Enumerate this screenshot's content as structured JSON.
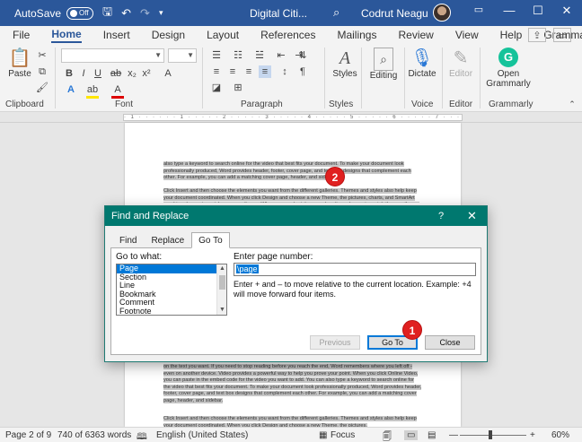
{
  "titlebar": {
    "autosave_label": "AutoSave",
    "autosave_state": "Off",
    "doc_title": "Digital Citi...",
    "user_name": "Codrut Neagu"
  },
  "menu": {
    "items": [
      "File",
      "Home",
      "Insert",
      "Design",
      "Layout",
      "References",
      "Mailings",
      "Review",
      "View",
      "Help",
      "Grammarly"
    ],
    "active": "Home"
  },
  "ribbon": {
    "groups": [
      "Clipboard",
      "Font",
      "Paragraph",
      "Styles",
      "Voice",
      "Editor",
      "Grammarly"
    ],
    "paste_label": "Paste",
    "styles_label": "Styles",
    "editing_label": "Editing",
    "dictate_label": "Dictate",
    "editor_label": "Editor",
    "open_grammarly_label": "Open Grammarly"
  },
  "document": {
    "paragraphs": [
      "also type a keyword to search online for the video that best fits your document. To make your document look professionally produced, Word provides header, footer, cover page, and text box designs that complement each other. For example, you can add a matching cover page, header, and sidebar.",
      "Click Insert and then choose the elements you want from the different galleries. Themes and styles also help keep your document coordinated. When you click Design and choose a new Theme, the pictures, charts, and SmartArt graphics change to match your new theme. When you apply styles, your headings change to match the new theme.",
      "on the text you want. If you need to stop reading before you reach the end, Word remembers where you left off - even on another device. Video provides a powerful way to help you prove your point. When you click Online Video, you can paste in the embed code for the video you want to add. You can also type a keyword to search online for the video that best fits your document. To make your document look professionally produced, Word provides header, footer, cover page, and text box designs that complement each other. For example, you can add a matching cover page, header, and sidebar.",
      "Click Insert and then choose the elements you want from the different galleries. Themes and styles also help keep your document coordinated. When you click Design and choose a new Theme, the pictures,"
    ]
  },
  "dialog": {
    "title": "Find and Replace",
    "help_glyph": "?",
    "close_glyph": "✕",
    "tabs": [
      "Find",
      "Replace",
      "Go To"
    ],
    "active_tab": "Go To",
    "goto_what_label": "Go to what:",
    "goto_items": [
      "Page",
      "Section",
      "Line",
      "Bookmark",
      "Comment",
      "Footnote"
    ],
    "selected_item": "Page",
    "enter_label": "Enter page number:",
    "input_value": "\\page",
    "hint": "Enter + and – to move relative to the current location. Example: +4 will move forward four items.",
    "previous_label": "Previous",
    "goto_label": "Go To",
    "close_label": "Close"
  },
  "annotations": {
    "badge_1": "1",
    "badge_2": "2"
  },
  "statusbar": {
    "page": "Page 2 of 9",
    "words": "740 of 6363 words",
    "language": "English (United States)",
    "focus": "Focus",
    "zoom": "60%"
  },
  "colors": {
    "word_blue": "#2b579a",
    "dialog_teal": "#00786f",
    "selection": "#0078d7",
    "badge_red": "#e02020"
  }
}
